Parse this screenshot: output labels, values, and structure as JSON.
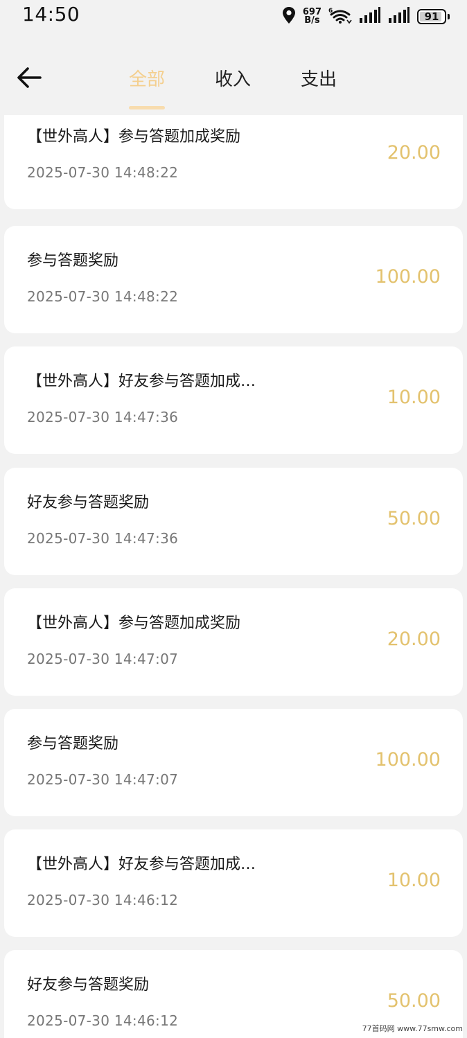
{
  "status_bar": {
    "time": "14:50",
    "net_speed_value": "697",
    "net_speed_unit": "B/s",
    "battery": "91",
    "battery_level": 91,
    "icons": [
      "location-icon",
      "wifi-icon",
      "signal-icon",
      "signal-icon",
      "battery-icon"
    ]
  },
  "header": {
    "back_icon": "arrow-left-icon",
    "tabs": [
      {
        "label": "全部",
        "active": true
      },
      {
        "label": "收入",
        "active": false
      },
      {
        "label": "支出",
        "active": false
      }
    ]
  },
  "colors": {
    "active_tab": "#f4cf8e",
    "amount": "#e3c26e",
    "background": "#f2f2f2"
  },
  "records": [
    {
      "title": "【世外高人】参与答题加成奖励",
      "time": "2025-07-30 14:48:22",
      "amount": "20.00"
    },
    {
      "title": "参与答题奖励",
      "time": "2025-07-30 14:48:22",
      "amount": "100.00"
    },
    {
      "title": "【世外高人】好友参与答题加成…",
      "time": "2025-07-30 14:47:36",
      "amount": "10.00"
    },
    {
      "title": "好友参与答题奖励",
      "time": "2025-07-30 14:47:36",
      "amount": "50.00"
    },
    {
      "title": "【世外高人】参与答题加成奖励",
      "time": "2025-07-30 14:47:07",
      "amount": "20.00"
    },
    {
      "title": "参与答题奖励",
      "time": "2025-07-30 14:47:07",
      "amount": "100.00"
    },
    {
      "title": "【世外高人】好友参与答题加成…",
      "time": "2025-07-30 14:46:12",
      "amount": "10.00"
    },
    {
      "title": "好友参与答题奖励",
      "time": "2025-07-30 14:46:12",
      "amount": "50.00"
    }
  ],
  "watermark": "77首码网 www.77smw.com"
}
